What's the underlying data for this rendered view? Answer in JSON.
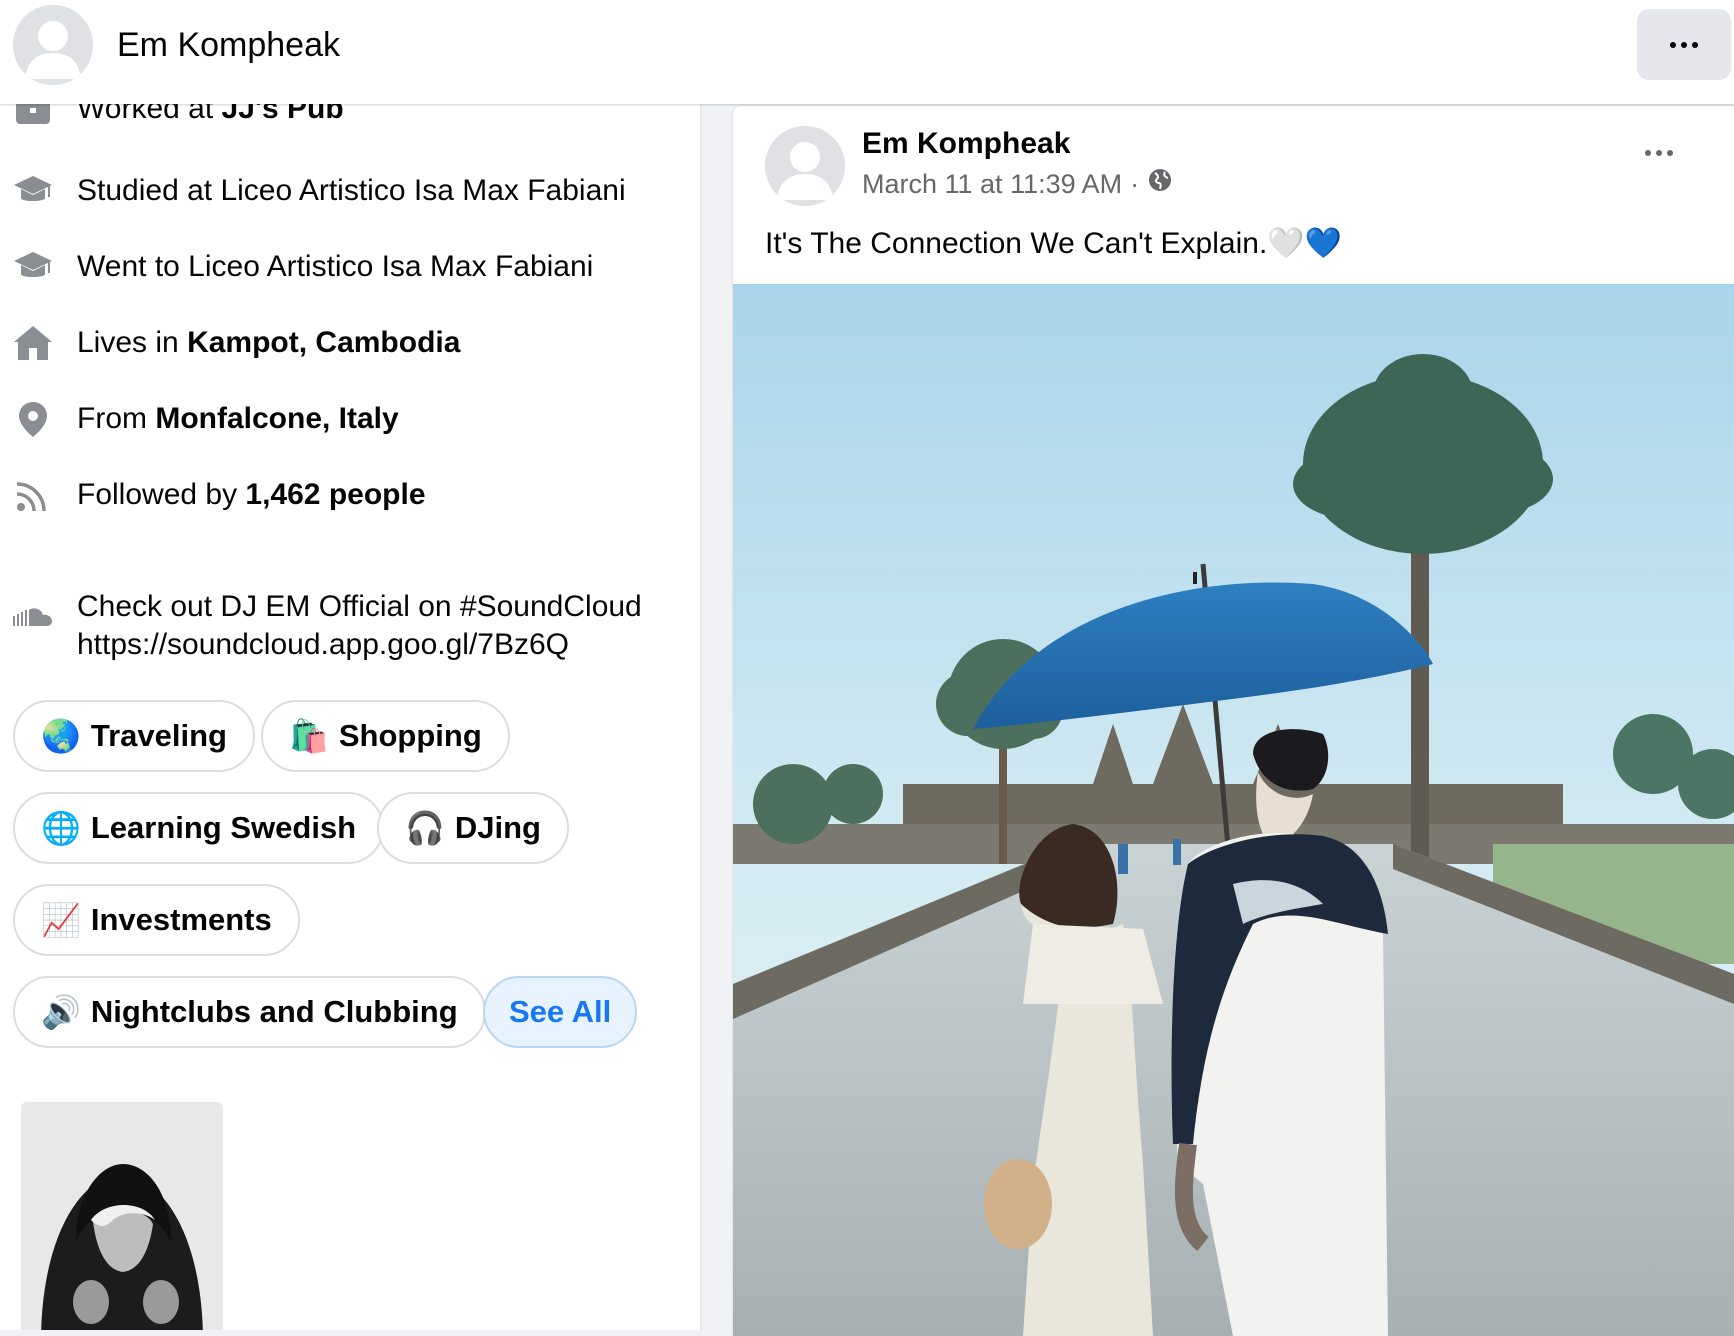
{
  "profile": {
    "name": "Em Kompheak"
  },
  "intro": {
    "work": {
      "prefix": "Worked at ",
      "place": "JJ's Pub"
    },
    "studied": {
      "text": "Studied at Liceo Artistico Isa Max Fabiani"
    },
    "went": {
      "text": "Went to Liceo Artistico Isa Max Fabiani"
    },
    "lives": {
      "prefix": "Lives in ",
      "place": "Kampot, Cambodia"
    },
    "from": {
      "prefix": "From ",
      "place": "Monfalcone, Italy"
    },
    "followers": {
      "prefix": "Followed by ",
      "count": "1,462 people"
    },
    "bio": {
      "line1": "Check out DJ EM Official on #SoundCloud",
      "line2": "https://soundcloud.app.goo.gl/7Bz6Q"
    }
  },
  "hobbies": [
    {
      "emoji": "🌏",
      "label": "Traveling"
    },
    {
      "emoji": "🛍️",
      "label": "Shopping"
    },
    {
      "emoji": "🌐",
      "label": "Learning Swedish"
    },
    {
      "emoji": "🎧",
      "label": "DJing"
    },
    {
      "emoji": "📈",
      "label": "Investments"
    },
    {
      "emoji": "🔊",
      "label": "Nightclubs and Clubbing"
    }
  ],
  "see_all_label": "See All",
  "post": {
    "author": "Em Kompheak",
    "time": "March 11 at 11:39 AM",
    "separator": "·",
    "text": "It's The Connection We Can't Explain.🤍💙"
  },
  "icons": {
    "work": "briefcase-icon",
    "education": "graduation-cap-icon",
    "home": "home-icon",
    "location": "map-pin-icon",
    "followers": "rss-icon",
    "bio": "soundcloud-icon",
    "privacy": "globe-icon"
  },
  "colors": {
    "accent": "#1877f2",
    "background": "#f0f2f5",
    "icon_gray": "#8a8d91"
  }
}
